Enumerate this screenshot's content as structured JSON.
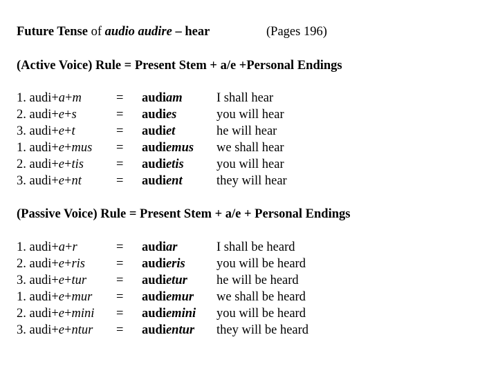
{
  "title": {
    "part1": "Future Tense",
    "part2": " of ",
    "part3": "audio audire",
    "part4": " – hear",
    "pages": "(Pages 196)"
  },
  "active": {
    "rule": "(Active Voice) Rule = Present Stem + a/e +Personal Endings",
    "rows": [
      {
        "num": "1. audi+",
        "vowel": "a",
        "ending": "m",
        "eq": "=",
        "stem": "audi",
        "suffix": "am",
        "translation": "I shall hear"
      },
      {
        "num": "2. audi+",
        "vowel": "e",
        "ending": "s",
        "eq": "=",
        "stem": "audi",
        "suffix": "es",
        "translation": "you will hear"
      },
      {
        "num": "3. audi+",
        "vowel": "e",
        "ending": "t",
        "eq": "=",
        "stem": "audi",
        "suffix": "et",
        "translation": "he will hear"
      },
      {
        "num": "1. audi+",
        "vowel": "e",
        "ending": "mus",
        "eq": "=",
        "stem": "audi",
        "suffix": "emus",
        "translation": "we shall hear"
      },
      {
        "num": "2. audi+",
        "vowel": "e",
        "ending": "tis",
        "eq": "=",
        "stem": "audi",
        "suffix": "etis",
        "translation": "you will hear"
      },
      {
        "num": "3. audi+",
        "vowel": "e",
        "ending": "nt",
        "eq": "=",
        "stem": "audi",
        "suffix": "ent",
        "translation": "they will hear"
      }
    ]
  },
  "passive": {
    "rule": "(Passive Voice) Rule = Present Stem + a/e + Personal Endings",
    "rows": [
      {
        "num": "1. audi+",
        "vowel": "a",
        "ending": "r",
        "eq": "=",
        "stem": "audi",
        "suffix": "ar",
        "translation": "I shall be heard"
      },
      {
        "num": "2. audi+",
        "vowel": "e",
        "ending": "ris",
        "eq": "=",
        "stem": "audi",
        "suffix": "eris",
        "translation": "you will be heard"
      },
      {
        "num": "3. audi+",
        "vowel": "e",
        "ending": "tur",
        "eq": "=",
        "stem": "audi",
        "suffix": "etur",
        "translation": "he will be heard"
      },
      {
        "num": "1. audi+",
        "vowel": "e",
        "ending": "mur",
        "eq": "=",
        "stem": "audi",
        "suffix": "emur",
        "translation": "we shall be heard"
      },
      {
        "num": "2. audi+",
        "vowel": "e",
        "ending": "mini",
        "eq": "=",
        "stem": "audi",
        "suffix": "emini",
        "translation": "you will be heard"
      },
      {
        "num": "3. audi+",
        "vowel": "e",
        "ending": "ntur",
        "eq": "=",
        "stem": "audi",
        "suffix": "entur",
        "translation": "they will be heard"
      }
    ]
  }
}
